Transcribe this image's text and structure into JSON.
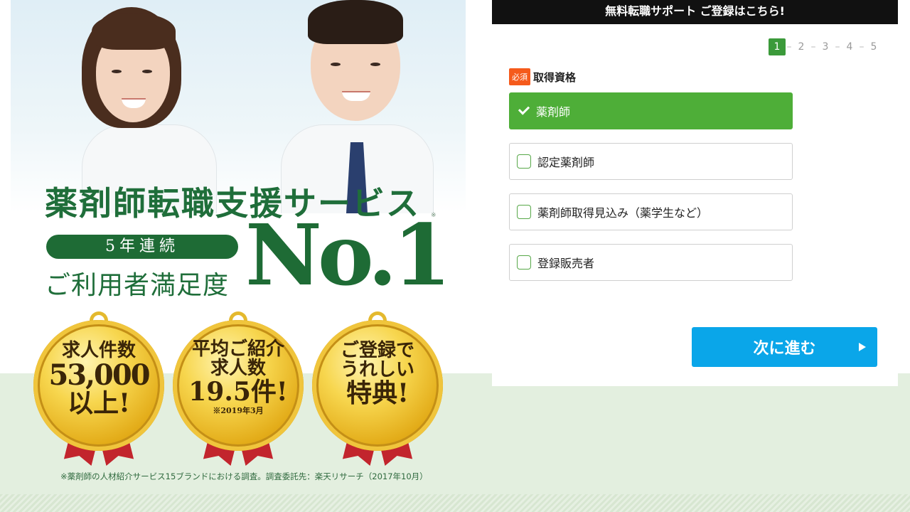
{
  "hero": {
    "headline": "薬剤師転職支援サービス",
    "note_mark": "※",
    "pill": "5年連続",
    "sub_headline": "ご利用者満足度",
    "no1": "No.1",
    "medals": [
      {
        "line1": "求人件数",
        "line2": "53,000",
        "line3": "以上!",
        "small": ""
      },
      {
        "line1": "平均ご紹介",
        "line2": "求人数",
        "line3": "19.5件!",
        "small": "※2019年3月"
      },
      {
        "line1": "ご登録で",
        "line2": "うれしい",
        "line3": "特典!",
        "small": ""
      }
    ],
    "footnote": "※薬剤師の人材紹介サービス15ブランドにおける調査。調査委託先：楽天リサーチ（2017年10月）"
  },
  "form": {
    "header": "無料転職サポート ご登録はこちら!",
    "steps": [
      "1",
      "2",
      "3",
      "4",
      "5"
    ],
    "active_step": "1",
    "required_badge": "必須",
    "field_label": "取得資格",
    "options": [
      {
        "label": "薬剤師",
        "selected": true
      },
      {
        "label": "認定薬剤師",
        "selected": false
      },
      {
        "label": "薬剤師取得見込み（薬学生など）",
        "selected": false
      },
      {
        "label": "登録販売者",
        "selected": false
      }
    ],
    "next_label": "次に進む"
  },
  "colors": {
    "brand_green": "#1e6b35",
    "option_selected": "#4eae38",
    "next_button": "#0aa6e9",
    "required_badge": "#f55a1b",
    "header_bg": "#111111"
  }
}
